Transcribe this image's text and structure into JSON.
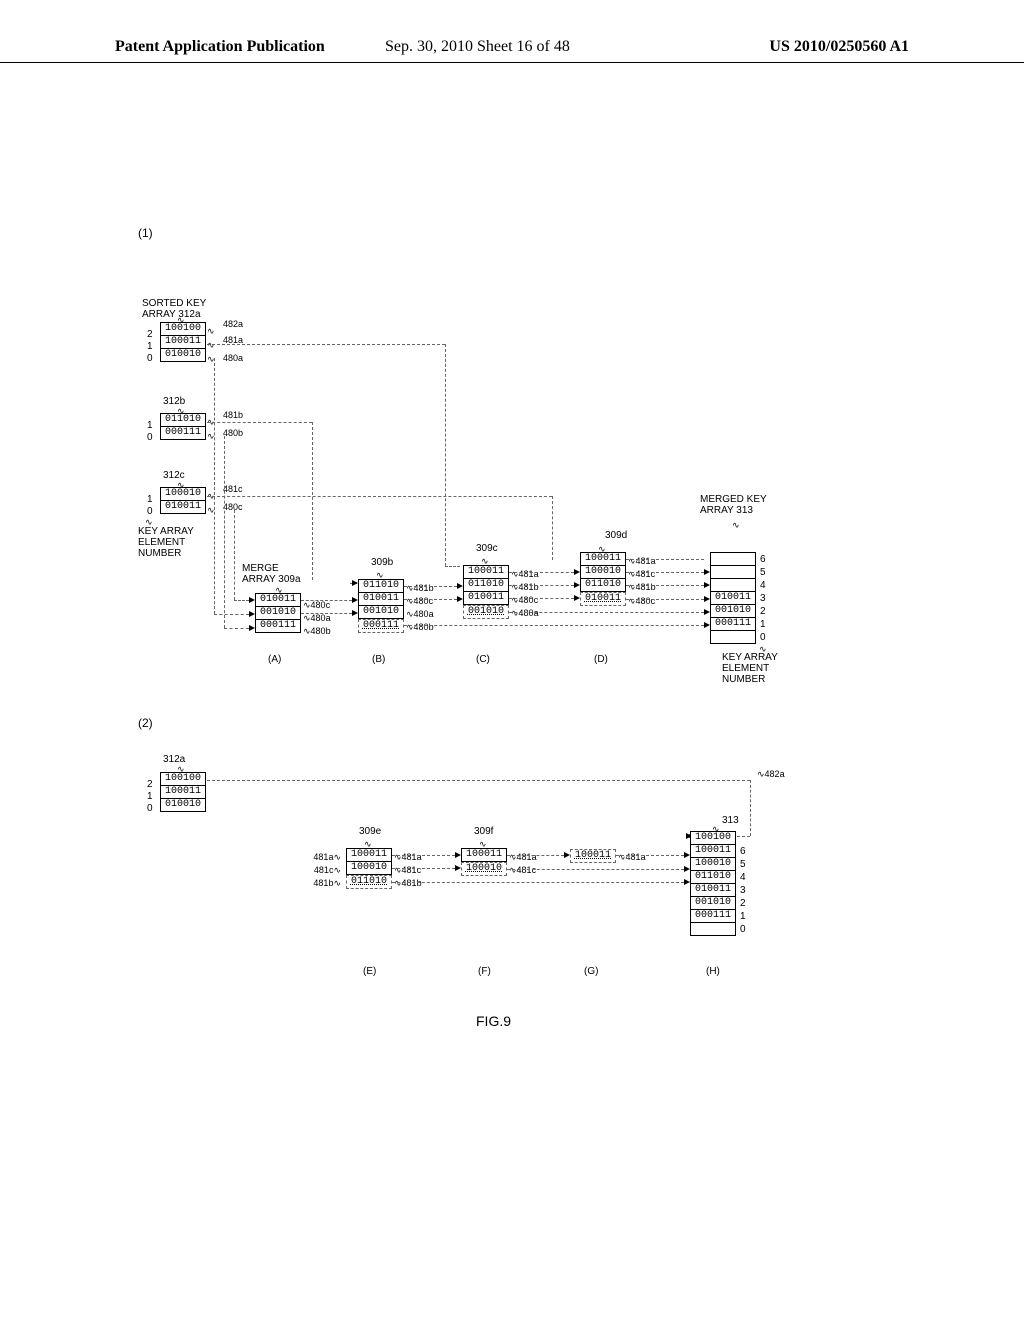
{
  "header": {
    "left": "Patent Application Publication",
    "center": "Sep. 30, 2010  Sheet 16 of 48",
    "right": "US 2010/0250560 A1"
  },
  "figure": {
    "num1": "(1)",
    "num2": "(2)",
    "sortedKeyLabel": "SORTED KEY\nARRAY 312a",
    "mergedKeyLabel": "MERGED KEY\nARRAY 313",
    "keyArrayElemLabel": "KEY ARRAY\nELEMENT\nNUMBER",
    "keyArrayElemLabel2": "KEY ARRAY\nELEMENT\nNUMBER",
    "title": "FIG.9",
    "arrays": {
      "a312a": {
        "label": "312a",
        "idx": [
          "2",
          "1",
          "0"
        ],
        "cells": [
          "100100",
          "100011",
          "010010"
        ],
        "refs": [
          "482a",
          "481a",
          "480a"
        ]
      },
      "a312b": {
        "label": "312b",
        "idx": [
          "1",
          "0"
        ],
        "cells": [
          "011010",
          "000111"
        ],
        "refs": [
          "481b",
          "480b"
        ]
      },
      "a312c": {
        "label": "312c",
        "idx": [
          "1",
          "0"
        ],
        "cells": [
          "100010",
          "010011"
        ],
        "refs": [
          "481c",
          "480c"
        ]
      },
      "merge309a": {
        "label": "MERGE\nARRAY 309a",
        "cells": [
          "010011",
          "001010",
          "000111"
        ],
        "refs": [
          "480c",
          "480a",
          "480b"
        ]
      },
      "m309b": {
        "label": "309b",
        "cells": [
          "011010",
          "010011",
          "001010",
          "000111"
        ],
        "refs": [
          "481b",
          "480c",
          "480a",
          "480b"
        ]
      },
      "m309c": {
        "label": "309c",
        "cells": [
          "100011",
          "011010",
          "010011",
          "001010"
        ],
        "refs": [
          "481a",
          "481b",
          "480c",
          "480a"
        ]
      },
      "m309d": {
        "label": "309d",
        "cells": [
          "100011",
          "100010",
          "011010",
          "010011"
        ],
        "refs": [
          "481a",
          "481c",
          "481b",
          "480c"
        ]
      },
      "m309e": {
        "label": "309e",
        "cells": [
          "100011",
          "100010",
          "011010"
        ],
        "refs": [
          "481a",
          "481c",
          "481b"
        ]
      },
      "m309f": {
        "label": "309f",
        "cells": [
          "100011",
          "100010"
        ],
        "refs": [
          "481a",
          "481c"
        ]
      },
      "mG": {
        "cells": [
          "100011"
        ],
        "refs": [
          "481a"
        ]
      },
      "merged313": {
        "label": "313",
        "idx": [
          "6",
          "5",
          "4",
          "3",
          "2",
          "1",
          "0"
        ],
        "cells": [
          "",
          "",
          "",
          "010011",
          "001010",
          "000111",
          ""
        ]
      },
      "merged313b": {
        "label": "313",
        "idx": [
          "6",
          "5",
          "4",
          "3",
          "2",
          "1",
          "0"
        ],
        "cells": [
          "100100",
          "100011",
          "100010",
          "011010",
          "010011",
          "001010",
          "000111",
          ""
        ]
      }
    },
    "stageLabels": {
      "A": "(A)",
      "B": "(B)",
      "C": "(C)",
      "D": "(D)",
      "E": "(E)",
      "F": "(F)",
      "G": "(G)",
      "H": "(H)"
    },
    "ref482a2": "482a"
  }
}
